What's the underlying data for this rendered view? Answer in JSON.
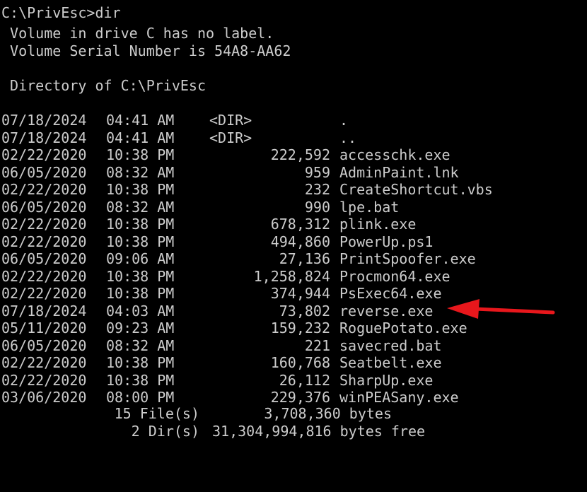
{
  "header": {
    "prompt_line": "C:\\PrivEsc>dir",
    "volume_label": " Volume in drive C has no label.",
    "volume_serial": " Volume Serial Number is 54A8-AA62",
    "directory_of": " Directory of C:\\PrivEsc"
  },
  "entries": [
    {
      "date": "07/18/2024",
      "time": "04:41 AM",
      "dir": "<DIR>",
      "size": "",
      "name": "."
    },
    {
      "date": "07/18/2024",
      "time": "04:41 AM",
      "dir": "<DIR>",
      "size": "",
      "name": ".."
    },
    {
      "date": "02/22/2020",
      "time": "10:38 PM",
      "dir": "",
      "size": "222,592",
      "name": "accesschk.exe"
    },
    {
      "date": "06/05/2020",
      "time": "08:32 AM",
      "dir": "",
      "size": "959",
      "name": "AdminPaint.lnk"
    },
    {
      "date": "02/22/2020",
      "time": "10:38 PM",
      "dir": "",
      "size": "232",
      "name": "CreateShortcut.vbs"
    },
    {
      "date": "06/05/2020",
      "time": "08:32 AM",
      "dir": "",
      "size": "990",
      "name": "lpe.bat"
    },
    {
      "date": "02/22/2020",
      "time": "10:38 PM",
      "dir": "",
      "size": "678,312",
      "name": "plink.exe"
    },
    {
      "date": "02/22/2020",
      "time": "10:38 PM",
      "dir": "",
      "size": "494,860",
      "name": "PowerUp.ps1"
    },
    {
      "date": "06/05/2020",
      "time": "09:06 AM",
      "dir": "",
      "size": "27,136",
      "name": "PrintSpoofer.exe"
    },
    {
      "date": "02/22/2020",
      "time": "10:38 PM",
      "dir": "",
      "size": "1,258,824",
      "name": "Procmon64.exe"
    },
    {
      "date": "02/22/2020",
      "time": "10:38 PM",
      "dir": "",
      "size": "374,944",
      "name": "PsExec64.exe"
    },
    {
      "date": "07/18/2024",
      "time": "04:03 AM",
      "dir": "",
      "size": "73,802",
      "name": "reverse.exe"
    },
    {
      "date": "05/11/2020",
      "time": "09:23 AM",
      "dir": "",
      "size": "159,232",
      "name": "RoguePotato.exe"
    },
    {
      "date": "06/05/2020",
      "time": "08:32 AM",
      "dir": "",
      "size": "221",
      "name": "savecred.bat"
    },
    {
      "date": "02/22/2020",
      "time": "10:38 PM",
      "dir": "",
      "size": "160,768",
      "name": "Seatbelt.exe"
    },
    {
      "date": "02/22/2020",
      "time": "10:38 PM",
      "dir": "",
      "size": "26,112",
      "name": "SharpUp.exe"
    },
    {
      "date": "03/06/2020",
      "time": "08:00 PM",
      "dir": "",
      "size": "229,376",
      "name": "winPEASany.exe"
    }
  ],
  "summary": {
    "files_count": "15 File(s)",
    "files_bytes": "3,708,360 bytes",
    "dirs_count": "2 Dir(s)",
    "dirs_bytes_free": "31,304,994,816 bytes free"
  },
  "colors": {
    "background": "#000000",
    "text": "#cccccc",
    "arrow": "#e8171c"
  },
  "annotation": {
    "arrow_icon": "red-arrow-icon"
  }
}
